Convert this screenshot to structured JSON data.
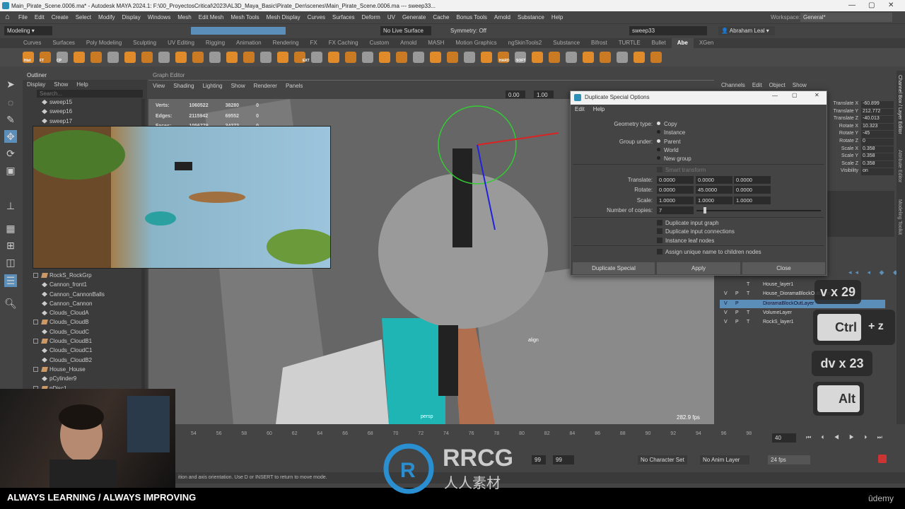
{
  "window": {
    "title": "Main_Pirate_Scene.0006.ma* - Autodesk MAYA 2024.1: F:\\00_ProyectosCritical\\2023\\AL3D_Maya_Basic\\Pirate_Den\\scenes\\Main_Pirate_Scene.0006.ma  ---  sweep33..."
  },
  "menu": [
    "File",
    "Edit",
    "Create",
    "Select",
    "Modify",
    "Display",
    "Windows",
    "Mesh",
    "Edit Mesh",
    "Mesh Tools",
    "Mesh Display",
    "Curves",
    "Surfaces",
    "Deform",
    "UV",
    "Generate",
    "Cache",
    "Bonus Tools",
    "Arnold",
    "Substance",
    "Help"
  ],
  "status": {
    "mode": "Modeling",
    "live_surface": "No Live Surface",
    "symmetry": "Symmetry: Off",
    "selection": "sweep33",
    "user": "Abraham Leal",
    "workspace_label": "Workspace:",
    "workspace": "General*"
  },
  "shelf_tabs": [
    "Curves",
    "Surfaces",
    "Poly Modeling",
    "Sculpting",
    "UV Editing",
    "Rigging",
    "Animation",
    "Rendering",
    "FX",
    "FX Caching",
    "Custom",
    "Arnold",
    "MASH",
    "Motion Graphics",
    "ngSkinTools2",
    "Substance",
    "Bifrost",
    "TURTLE",
    "Bullet",
    "Abe",
    "XGen"
  ],
  "shelf_active": "Abe",
  "shelf_labels": [
    "Hist",
    "FT",
    "CP",
    "EXT",
    "HARD",
    "SOFT"
  ],
  "outliner": {
    "title": "Outliner",
    "menu": [
      "Display",
      "Show",
      "Help"
    ],
    "search_placeholder": "Search...",
    "items_top": [
      {
        "name": "sweep15",
        "group": false
      },
      {
        "name": "sweep16",
        "group": false
      },
      {
        "name": "sweep17",
        "group": false
      }
    ],
    "items": [
      {
        "name": "RockS_RockGrp",
        "group": true
      },
      {
        "name": "Cannon_front1",
        "group": false
      },
      {
        "name": "Cannon_CannonBalls",
        "group": false
      },
      {
        "name": "Cannon_Cannon",
        "group": false
      },
      {
        "name": "Clouds_CloudA",
        "group": false
      },
      {
        "name": "Clouds_CloudB",
        "group": true
      },
      {
        "name": "Clouds_CloudC",
        "group": false
      },
      {
        "name": "Clouds_CloudB1",
        "group": true
      },
      {
        "name": "Clouds_CloudC1",
        "group": false
      },
      {
        "name": "Clouds_CloudB2",
        "group": false
      },
      {
        "name": "House_House",
        "group": true
      },
      {
        "name": "pCylinder9",
        "group": false
      },
      {
        "name": "pDisc1",
        "group": true
      }
    ]
  },
  "viewport": {
    "panel_title": "Graph Editor",
    "menu": [
      "View",
      "Shading",
      "Lighting",
      "Show",
      "Renderer",
      "Panels"
    ],
    "field1": "0.00",
    "field2": "1.00",
    "stats": [
      {
        "label": "Verts:",
        "a": "1060522",
        "b": "38280",
        "c": "0"
      },
      {
        "label": "Edges:",
        "a": "2115942",
        "b": "69552",
        "c": "0"
      },
      {
        "label": "Faces:",
        "a": "1056779",
        "b": "34272",
        "c": "0"
      }
    ],
    "camera": "persp",
    "fps": "282.9 fps",
    "cursor_label": "align"
  },
  "dialog": {
    "title": "Duplicate Special Options",
    "menu": [
      "Edit",
      "Help"
    ],
    "geometry_type_label": "Geometry type:",
    "geometry_options": [
      "Copy",
      "Instance"
    ],
    "geometry_selected": "Copy",
    "group_under_label": "Group under:",
    "group_options": [
      "Parent",
      "World",
      "New group"
    ],
    "group_selected": "Parent",
    "smart_transform": "Smart transform",
    "translate_label": "Translate:",
    "translate": [
      "0.0000",
      "0.0000",
      "0.0000"
    ],
    "rotate_label": "Rotate:",
    "rotate": [
      "0.0000",
      "45.0000",
      "0.0000"
    ],
    "scale_label": "Scale:",
    "scale": [
      "1.0000",
      "1.0000",
      "1.0000"
    ],
    "copies_label": "Number of copies:",
    "copies": "7",
    "checkboxes": [
      "Duplicate input graph",
      "Duplicate input connections",
      "Instance leaf nodes"
    ],
    "assign_unique": "Assign unique name to children nodes",
    "buttons": [
      "Duplicate Special",
      "Apply",
      "Close"
    ]
  },
  "channel_box": {
    "menu": [
      "Channels",
      "Edit",
      "Object",
      "Show"
    ],
    "channels": [
      {
        "label": "Translate X",
        "value": "-60.899"
      },
      {
        "label": "Translate Y",
        "value": "212.772"
      },
      {
        "label": "Translate Z",
        "value": "-40.013"
      },
      {
        "label": "Rotate X",
        "value": "10.323"
      },
      {
        "label": "Rotate Y",
        "value": "-45"
      },
      {
        "label": "Rotate Z",
        "value": "0"
      },
      {
        "label": "Scale X",
        "value": "0.358"
      },
      {
        "label": "Scale Y",
        "value": "0.358"
      },
      {
        "label": "Scale Z",
        "value": "0.358"
      },
      {
        "label": "Visibility",
        "value": "on"
      }
    ]
  },
  "layers": [
    {
      "v": "",
      "p": "",
      "t": "T",
      "name": "House_layer1",
      "selected": false
    },
    {
      "v": "V",
      "p": "P",
      "t": "T",
      "name": "House_DioramaBlockOutLayer",
      "selected": false
    },
    {
      "v": "V",
      "p": "P",
      "t": "",
      "name": "DioramaBlockOutLayer",
      "selected": true
    },
    {
      "v": "V",
      "p": "P",
      "t": "T",
      "name": "VolumeLayer",
      "selected": false
    },
    {
      "v": "V",
      "p": "P",
      "t": "T",
      "name": "RockS_layer1",
      "selected": false
    }
  ],
  "side_tabs": [
    "Channel Box / Layer Editor",
    "Attribute Editor",
    "Modeling Toolkit"
  ],
  "keystrokes": {
    "k1": "v x 29",
    "k2_key": "Ctrl",
    "k2_rest": "+ z",
    "k3": "dv x 23",
    "k4": "Alt"
  },
  "timeline": {
    "ticks": [
      "54",
      "56",
      "58",
      "60",
      "62",
      "64",
      "66",
      "68",
      "70",
      "72",
      "74",
      "76",
      "78",
      "80",
      "82",
      "84",
      "86",
      "88",
      "90",
      "92",
      "94",
      "96",
      "98"
    ],
    "current_frame": "40",
    "range_end1": "99",
    "range_end2": "99",
    "character_set": "No Character Set",
    "anim_layer": "No Anim Layer",
    "fps": "24 fps"
  },
  "help_line": "ition and axis orientation. Use D or INSERT to return to move mode.",
  "banner": "ALWAYS LEARNING  / ALWAYS IMPROVING",
  "watermark": {
    "brand": "RRCG",
    "sub": "人人素材"
  },
  "udemy": "ûdemy"
}
